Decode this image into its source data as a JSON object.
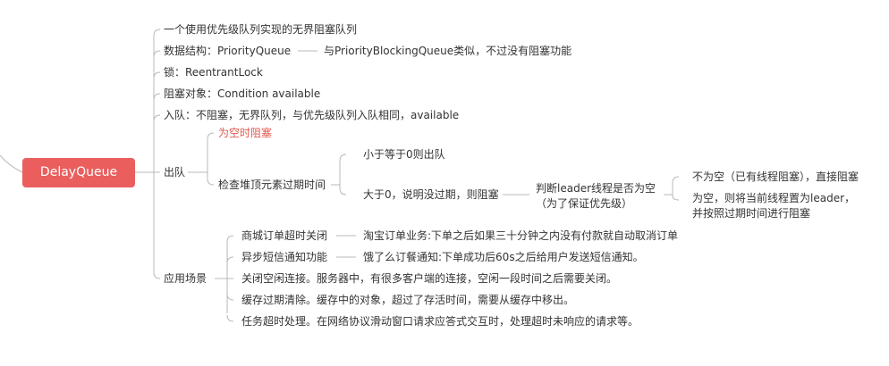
{
  "root": "DelayQueue",
  "top_items": [
    "一个使用优先级队列实现的无界阻塞队列",
    "数据结构：PriorityQueue",
    "与PriorityBlockingQueue类似，不过没有阻塞功能",
    "锁：ReentrantLock",
    "阻塞对象：Condition available",
    "入队：不阻塞，无界队列，与优先级队列入队相同，available"
  ],
  "dequeue": {
    "label": "出队",
    "empty": "为空时阻塞",
    "check": "检查堆顶元素过期时间",
    "le_zero": "小于等于0则出队",
    "gt_zero": "大于0，说明没过期，则阻塞",
    "leader_q1": "判断leader线程是否为空",
    "leader_q2": "（为了保证优先级）",
    "not_empty": "不为空（已有线程阻塞），直接阻塞",
    "empty_line1": "为空，则将当前线程置为leader，",
    "empty_line2": "并按照过期时间进行阻塞"
  },
  "scenarios": {
    "label": "应用场景",
    "items": [
      "商城订单超时关闭",
      "异步短信通知功能",
      "关闭空闲连接。服务器中，有很多客户端的连接，空闲一段时间之后需要关闭。",
      "缓存过期清除。缓存中的对象，超过了存活时间，需要从缓存中移出。",
      "任务超时处理。在网络协议滑动窗口请求应答式交互时，处理超时未响应的请求等。"
    ],
    "details": [
      "淘宝订单业务:下单之后如果三十分钟之内没有付款就自动取消订单",
      "饿了么订餐通知:下单成功后60s之后给用户发送短信通知。"
    ]
  },
  "colors": {
    "root_bg": "#eb5e5e",
    "highlight_text": "#e05a50",
    "connector": "#b8b8b8"
  }
}
